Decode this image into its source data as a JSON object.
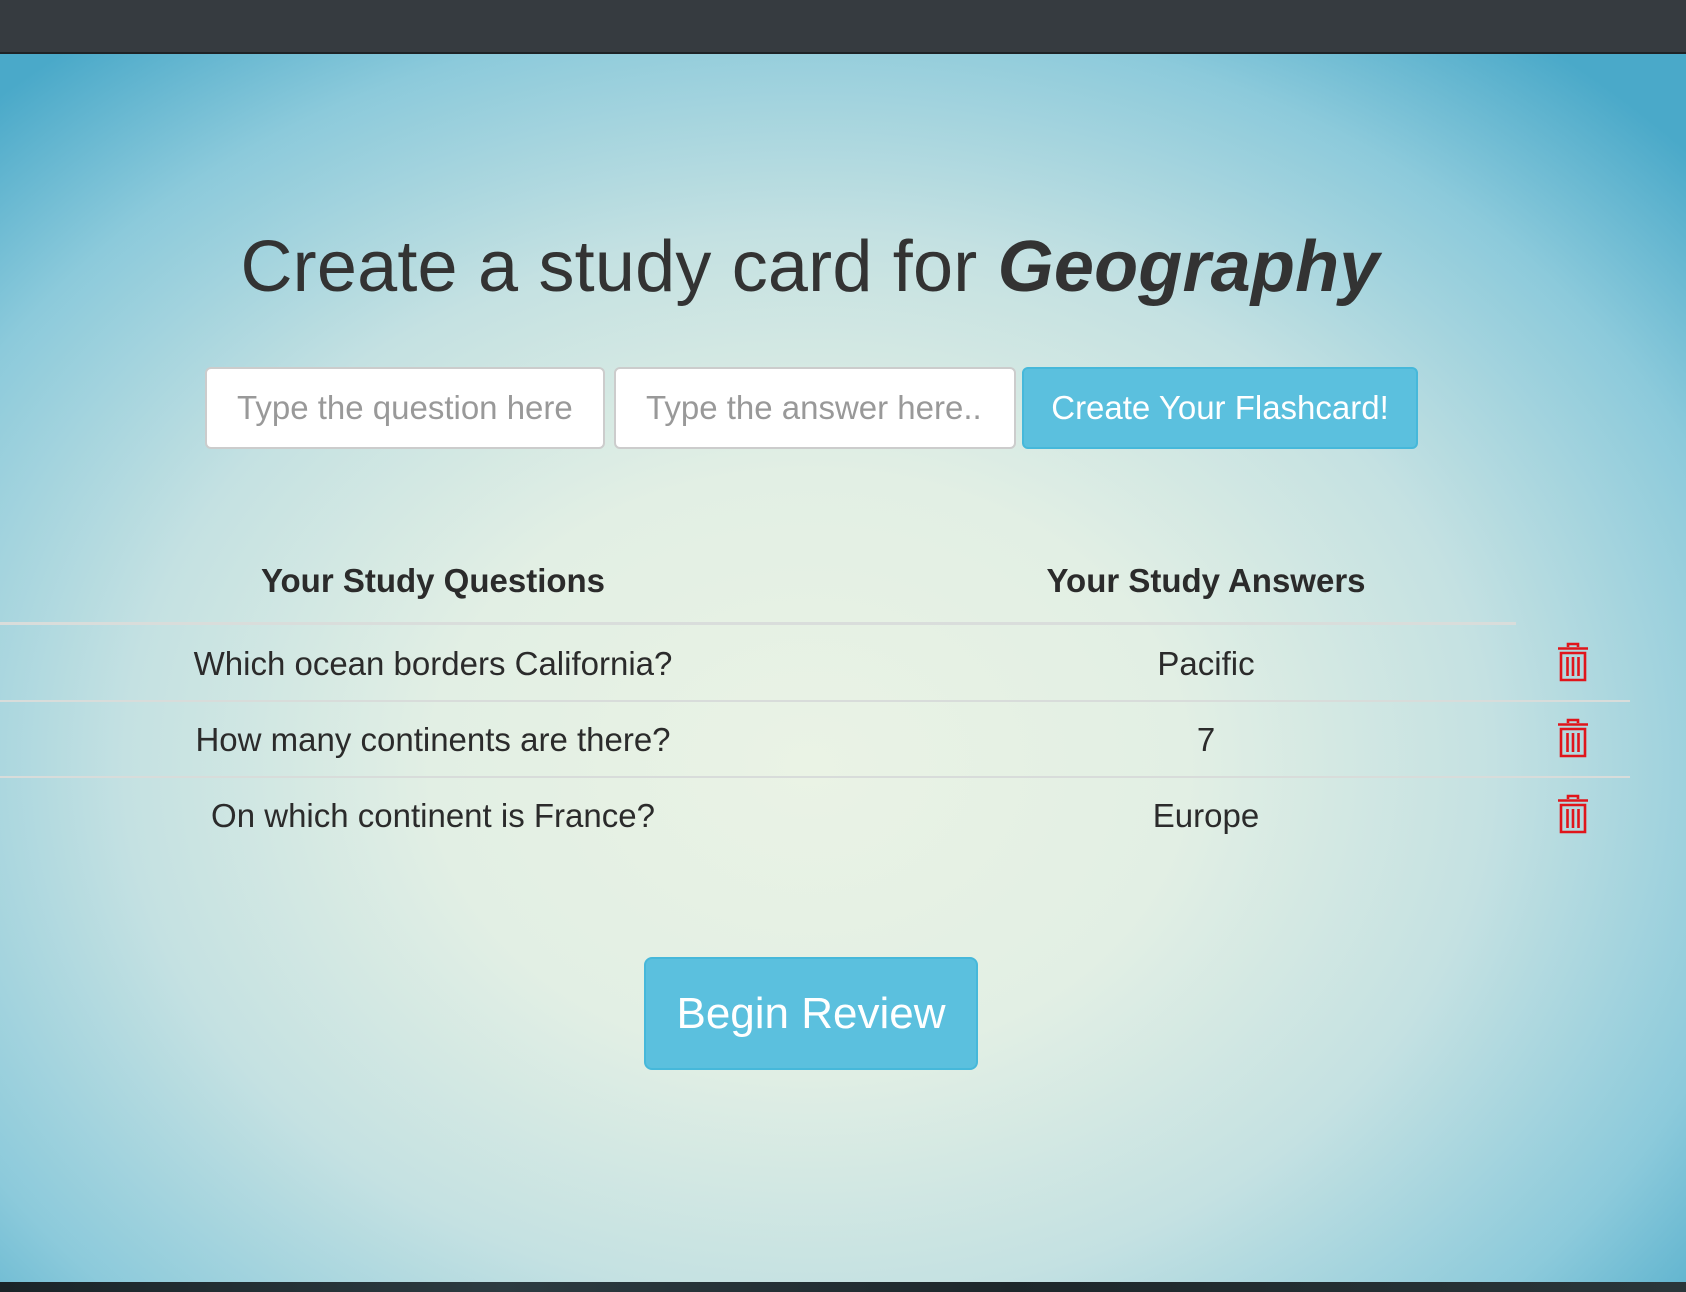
{
  "heading": {
    "prefix": "Create a study card for ",
    "subject": "Geography"
  },
  "form": {
    "question_placeholder": "Type the question here",
    "answer_placeholder": "Type the answer here...",
    "create_label": "Create Your Flashcard!"
  },
  "table": {
    "headers": [
      "Your Study Questions",
      "Your Study Answers"
    ],
    "rows": [
      {
        "question": "Which ocean borders California?",
        "answer": "Pacific",
        "delete_icon": "trash-icon"
      },
      {
        "question": "How many continents are there?",
        "answer": "7",
        "delete_icon": "trash-icon"
      },
      {
        "question": "On which continent is France?",
        "answer": "Europe",
        "delete_icon": "trash-icon"
      }
    ]
  },
  "review_button": {
    "label": "Begin Review"
  },
  "colors": {
    "accent": "#5bc0de",
    "delete": "#e0151b",
    "text": "#333333"
  }
}
